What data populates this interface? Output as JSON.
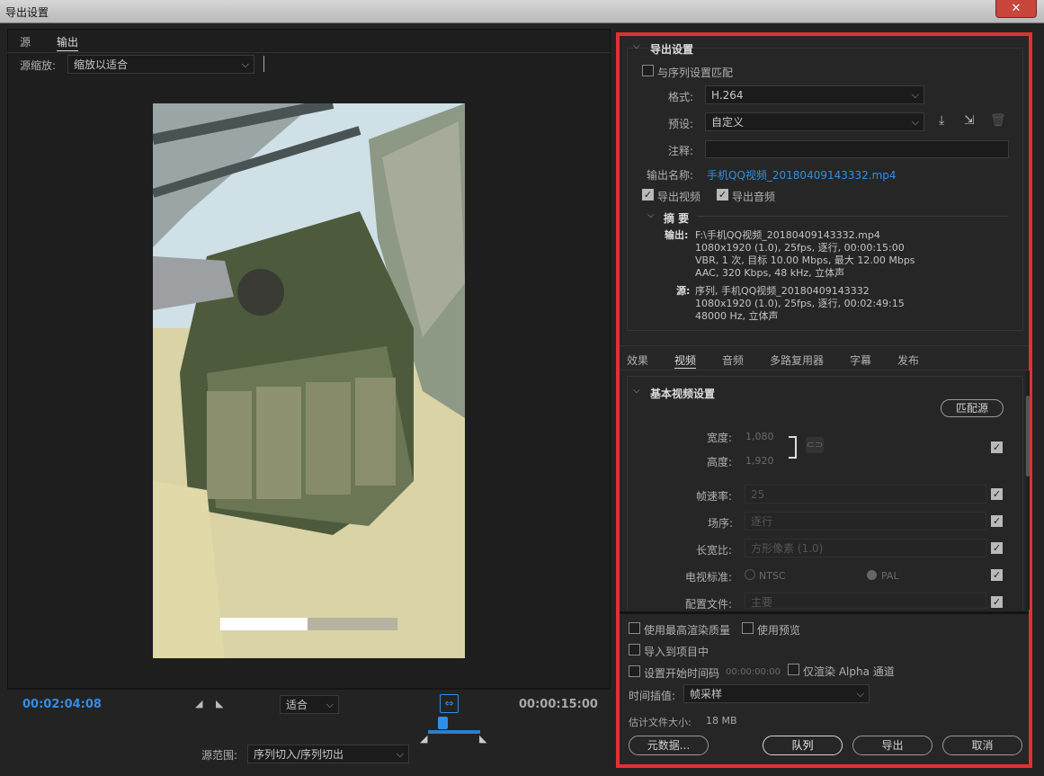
{
  "window": {
    "title": "导出设置",
    "close": "✕"
  },
  "left": {
    "tabs": [
      "源",
      "输出"
    ],
    "source_scale_label": "源缩放:",
    "source_scale_value": "缩放以适合",
    "current_time": "00:02:04:08",
    "fit_value": "适合",
    "duration": "00:00:15:00",
    "source_range_label": "源范围:",
    "source_range_value": "序列切入/序列切出",
    "progress": 0.5
  },
  "export_settings": {
    "header": "导出设置",
    "match_sequence": "与序列设置匹配",
    "format_label": "格式:",
    "format_value": "H.264",
    "preset_label": "预设:",
    "preset_value": "自定义",
    "comments_label": "注释:",
    "comments_value": "",
    "output_name_label": "输出名称:",
    "output_name_value": "手机QQ视频_20180409143332.mp4",
    "export_video": "导出视频",
    "export_audio": "导出音频",
    "summary_header": "摘 要",
    "output_label": "输出:",
    "output_lines": [
      "F:\\手机QQ视频_20180409143332.mp4",
      "1080x1920 (1.0), 25fps, 逐行, 00:00:15:00",
      "VBR, 1 次, 目标 10.00 Mbps, 最大 12.00 Mbps",
      "AAC, 320 Kbps, 48 kHz, 立体声"
    ],
    "source_label": "源:",
    "source_lines": [
      "序列, 手机QQ视频_20180409143332",
      "1080x1920 (1.0), 25fps, 逐行, 00:02:49:15",
      "48000 Hz, 立体声"
    ]
  },
  "tabs2": [
    "效果",
    "视频",
    "音频",
    "多路复用器",
    "字幕",
    "发布"
  ],
  "video": {
    "header": "基本视频设置",
    "match_source": "匹配源",
    "width_label": "宽度:",
    "width_value": "1,080",
    "height_label": "高度:",
    "height_value": "1,920",
    "framerate_label": "帧速率:",
    "framerate_value": "25",
    "field_label": "场序:",
    "field_value": "逐行",
    "aspect_label": "长宽比:",
    "aspect_value": "方形像素 (1.0)",
    "tv_label": "电视标准:",
    "ntsc": "NTSC",
    "pal": "PAL",
    "profile_label": "配置文件:",
    "profile_value": "主要"
  },
  "bottom": {
    "max_render": "使用最高渲染质量",
    "use_preview": "使用预览",
    "import_project": "导入到项目中",
    "set_timecode": "设置开始时间码",
    "timecode_value": "00:00:00:00",
    "alpha_only": "仅渲染 Alpha 通道",
    "interp_label": "时间插值:",
    "interp_value": "帧采样",
    "filesize_label": "估计文件大小:",
    "filesize_value": "18 MB",
    "metadata": "元数据...",
    "queue": "队列",
    "export": "导出",
    "cancel": "取消"
  },
  "colors": {
    "accent": "#2f8fe6",
    "highlight": "#e03232"
  }
}
